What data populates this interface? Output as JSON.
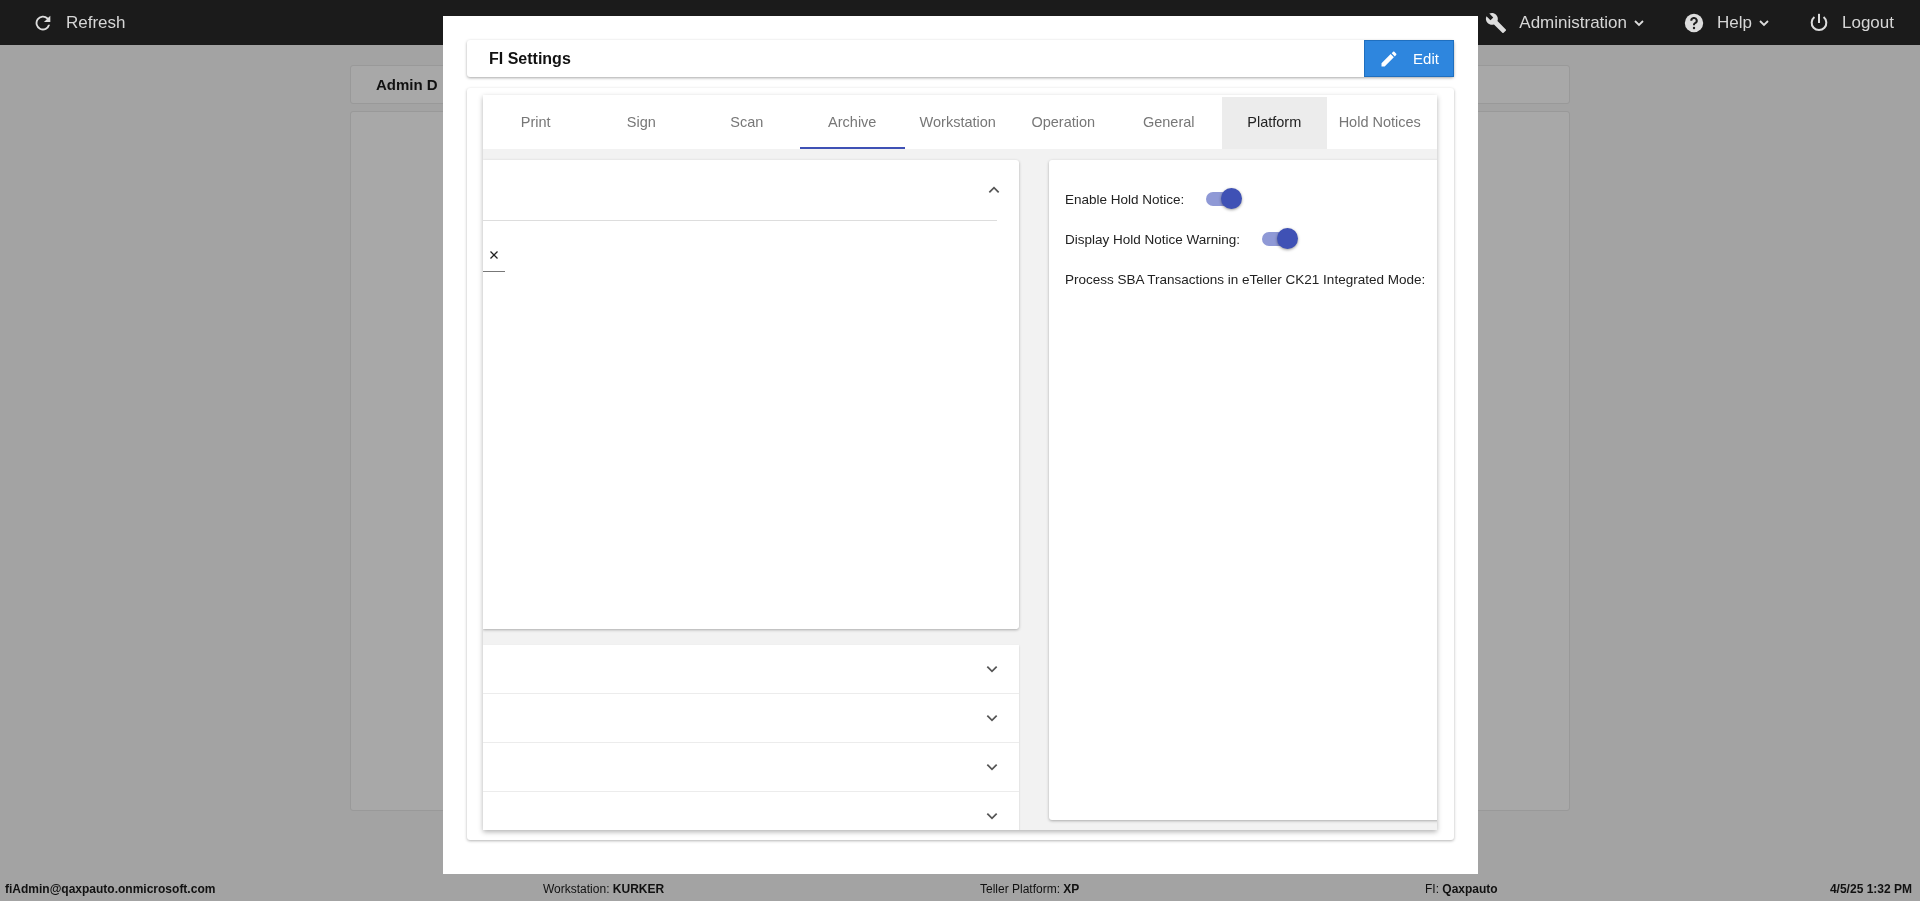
{
  "top_bar": {
    "refresh": "Refresh",
    "menus": [
      {
        "label": "Administration",
        "kind": "admin",
        "dropdown": true
      },
      {
        "label": "Help",
        "kind": "help",
        "dropdown": true
      },
      {
        "label": "Logout",
        "kind": "logout",
        "dropdown": false
      }
    ]
  },
  "background": {
    "card_title": "Admin D"
  },
  "modal": {
    "title": "FI Settings",
    "edit_button": "Edit",
    "tabs": [
      {
        "label": "Print",
        "selected": false,
        "highlighted": false
      },
      {
        "label": "Sign",
        "selected": false,
        "highlighted": false
      },
      {
        "label": "Scan",
        "selected": false,
        "highlighted": false
      },
      {
        "label": "Archive",
        "selected": true,
        "highlighted": false
      },
      {
        "label": "Workstation",
        "selected": false,
        "highlighted": false
      },
      {
        "label": "Operation",
        "selected": false,
        "highlighted": false
      },
      {
        "label": "General",
        "selected": false,
        "highlighted": false
      },
      {
        "label": "Platform",
        "selected": false,
        "highlighted": true
      },
      {
        "label": "Hold Notices",
        "selected": false,
        "highlighted": false
      }
    ],
    "panels": [
      {
        "expanded": true
      },
      {
        "expanded": false
      },
      {
        "expanded": false
      },
      {
        "expanded": false
      },
      {
        "expanded": false
      }
    ],
    "settings": [
      {
        "label": "Enable Hold Notice:",
        "kind": "toggle",
        "on": true
      },
      {
        "label": "Display Hold Notice Warning:",
        "kind": "toggle",
        "on": true
      },
      {
        "label": "Process SBA Transactions in eTeller CK21 Integrated Mode:",
        "kind": "text"
      }
    ]
  },
  "status_bar": {
    "user": "fiAdmin@qaxpauto.onmicrosoft.com",
    "workstation": "Workstation: **KURKER**",
    "platform": "Teller Platform: **XP**",
    "fi": "FI: **Qaxpauto**",
    "datetime": "4/5/25 1:32 PM"
  }
}
